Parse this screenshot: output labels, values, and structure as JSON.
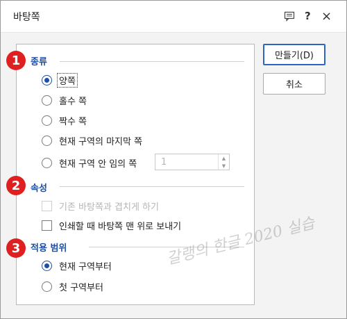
{
  "window": {
    "title": "바탕쪽"
  },
  "titlebar_icons": [
    "comment-icon",
    "help-icon",
    "close-icon"
  ],
  "titlebar_text": {
    "help": "?",
    "close": "×"
  },
  "sections": {
    "kind": {
      "badge": "1",
      "label": "종류"
    },
    "props": {
      "badge": "2",
      "label": "속성"
    },
    "scope": {
      "badge": "3",
      "label": "적용 범위"
    }
  },
  "kind_options": [
    {
      "label": "양쪽",
      "checked": true
    },
    {
      "label": "홀수 쪽",
      "checked": false
    },
    {
      "label": "짝수 쪽",
      "checked": false
    },
    {
      "label": "현재 구역의 마지막 쪽",
      "checked": false
    },
    {
      "label": "현재 구역 안 임의 쪽",
      "checked": false
    }
  ],
  "page_spinner": {
    "value": "1"
  },
  "property_options": [
    {
      "label": "기존 바탕쪽과 겹치게 하기",
      "checked": false,
      "disabled": true
    },
    {
      "label": "인쇄할 때 바탕쪽 맨 위로 보내기",
      "checked": false,
      "disabled": false
    }
  ],
  "scope_options": [
    {
      "label": "현재 구역부터",
      "checked": true
    },
    {
      "label": "첫 구역부터",
      "checked": false
    }
  ],
  "buttons": {
    "create": "만들기(D)",
    "cancel": "취소"
  },
  "watermark": "갈랭의 한글 2020 실습",
  "colors": {
    "section_label": "#1f4fa3",
    "badge": "#e02020",
    "primary_border": "#2b63c6"
  }
}
